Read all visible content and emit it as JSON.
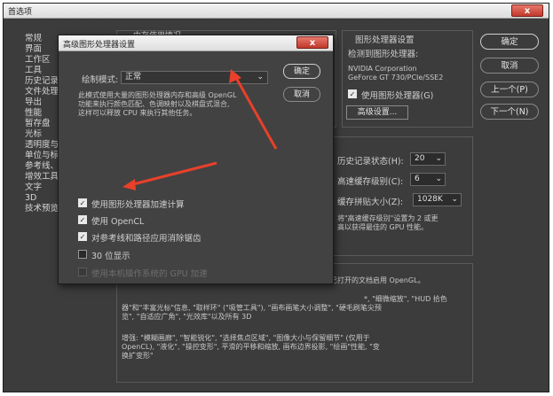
{
  "window": {
    "title": "首选项",
    "close_label": "x"
  },
  "sidebar": {
    "items": [
      {
        "label": "常规"
      },
      {
        "label": "界面"
      },
      {
        "label": "工作区"
      },
      {
        "label": "工具"
      },
      {
        "label": "历史记录"
      },
      {
        "label": "文件处理"
      },
      {
        "label": "导出"
      },
      {
        "label": "性能"
      },
      {
        "label": "暂存盘"
      },
      {
        "label": "光标"
      },
      {
        "label": "透明度与"
      },
      {
        "label": "单位与标"
      },
      {
        "label": "参考线、"
      },
      {
        "label": "增效工具"
      },
      {
        "label": "文字"
      },
      {
        "label": "3D"
      },
      {
        "label": "技术预览"
      }
    ]
  },
  "right_buttons": {
    "ok": "确定",
    "cancel": "取消",
    "prev": "上一个(P)",
    "next": "下一个(N)"
  },
  "memory_panel": {
    "title_partial": "内存使用情况"
  },
  "gpu_panel": {
    "title": "图形处理器设置",
    "detected_label": "检测到图形处理器:",
    "gpu_vendor": "NVIDIA Corporation",
    "gpu_model": "GeForce GT 730/PCIe/SSE2",
    "use_gpu_label": "使用图形处理器(G)",
    "use_gpu_checked": true,
    "advanced_button": "高级设置..."
  },
  "history_panel": {
    "history_label": "历史记录状态(H):",
    "history_value": "20",
    "cache_levels_label": "高速缓存级别(C):",
    "cache_levels_value": "6",
    "tile_size_label": "缓存拼贴大小(Z):",
    "tile_size_value": "1028K",
    "hint_line1": "将\"高速缓存级别\"设置为 2 或更",
    "hint_line2": "高以获得最佳的 GPU 性能。"
  },
  "description_panel": {
    "line1": "已打开的文档启用 OpenGL。",
    "line2": "*, \"细微缩放\", \"HUD 拾色",
    "line3": "器\"和\"丰富光标\"信息, \"取样环\" (\"吸管工具\"), \"画布画笔大小调整\", \"硬毛刷笔尖预",
    "line4": "览\", \"自适应广角\", \"光效库\"以及所有 3D",
    "line5": "增强: \"模糊画廊\", \"智能锐化\", \"选择焦点区域\", \"图像大小与保留细节\" (仅用于",
    "line6": "OpenCL), \"液化\", \"操控变形\", 平滑的平移和缩放, 画布边界投影, \"绘画\"性能, \"变",
    "line7": "换扩变形\""
  },
  "dialog": {
    "title": "高级图形处理器设置",
    "close_label": "x",
    "drawing_mode_label": "绘制模式:",
    "drawing_mode_value": "正常",
    "ok": "确定",
    "cancel": "取消",
    "desc_line1": "此模式使用大量的图形处理器内存和高级 OpenGL",
    "desc_line2": "功能来执行颜色匹配、色调映射以及棋盘式混合,",
    "desc_line3": "这样可以释放 CPU 来执行其他任务。",
    "options": [
      {
        "label": "使用图形处理器加速计算",
        "checked": true,
        "disabled": false
      },
      {
        "label": "使用 OpenCL",
        "checked": true,
        "disabled": false
      },
      {
        "label": "对参考线和路径应用消除锯齿",
        "checked": true,
        "disabled": false
      },
      {
        "label": "30 位显示",
        "checked": false,
        "disabled": false
      },
      {
        "label": "使用本机操作系统的 GPU 加速",
        "checked": false,
        "disabled": true
      }
    ]
  },
  "colors": {
    "panel_bg": "#3c3c3c",
    "annotation_arrow": "#e8402a"
  }
}
